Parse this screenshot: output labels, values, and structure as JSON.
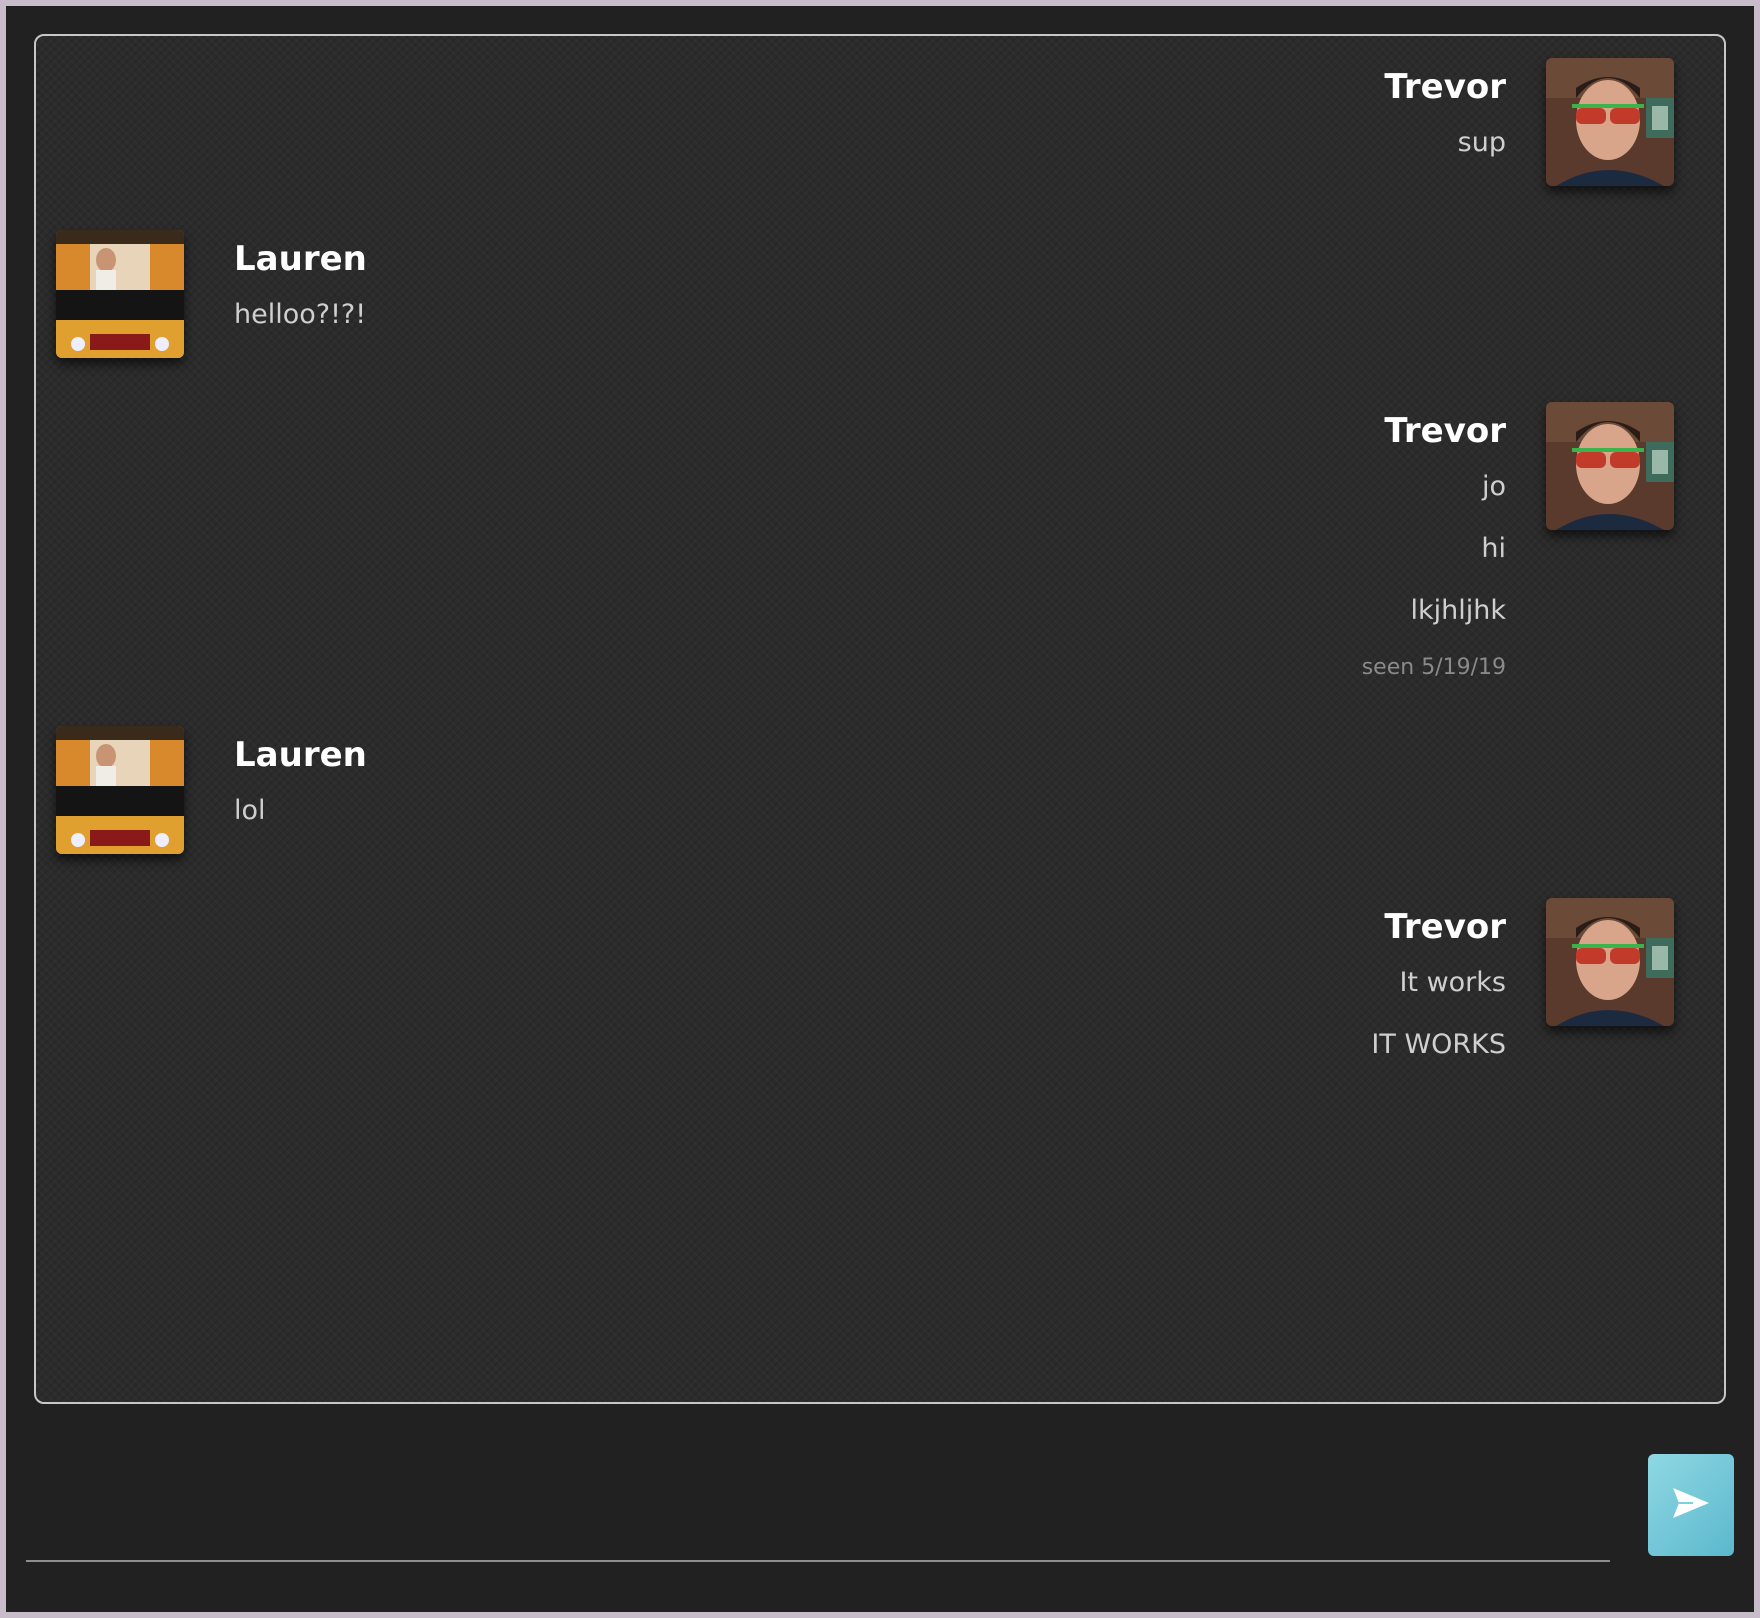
{
  "messages": [
    {
      "sender": "Trevor",
      "side": "right",
      "avatar": "trevor-avatar",
      "lines": [
        "sup"
      ]
    },
    {
      "sender": "Lauren",
      "side": "left",
      "avatar": "lauren-avatar",
      "lines": [
        "helloo?!?!"
      ]
    },
    {
      "sender": "Trevor",
      "side": "right",
      "avatar": "trevor-avatar",
      "lines": [
        "jo",
        "hi",
        "lkjhljhk"
      ],
      "seen": "seen 5/19/19"
    },
    {
      "sender": "Lauren",
      "side": "left",
      "avatar": "lauren-avatar",
      "lines": [
        "lol"
      ]
    },
    {
      "sender": "Trevor",
      "side": "right",
      "avatar": "trevor-avatar",
      "lines": [
        "It works",
        "IT WORKS"
      ]
    }
  ],
  "composer": {
    "value": "",
    "placeholder": ""
  },
  "send_button": {
    "icon": "send-icon"
  },
  "colors": {
    "background": "#222122",
    "panel": "#2b2b2b",
    "panel_border": "#c9c6c9",
    "name": "#ffffff",
    "message": "#cfcfcf",
    "seen": "#8a8a8a",
    "send_accent": "#7fcfdd"
  }
}
